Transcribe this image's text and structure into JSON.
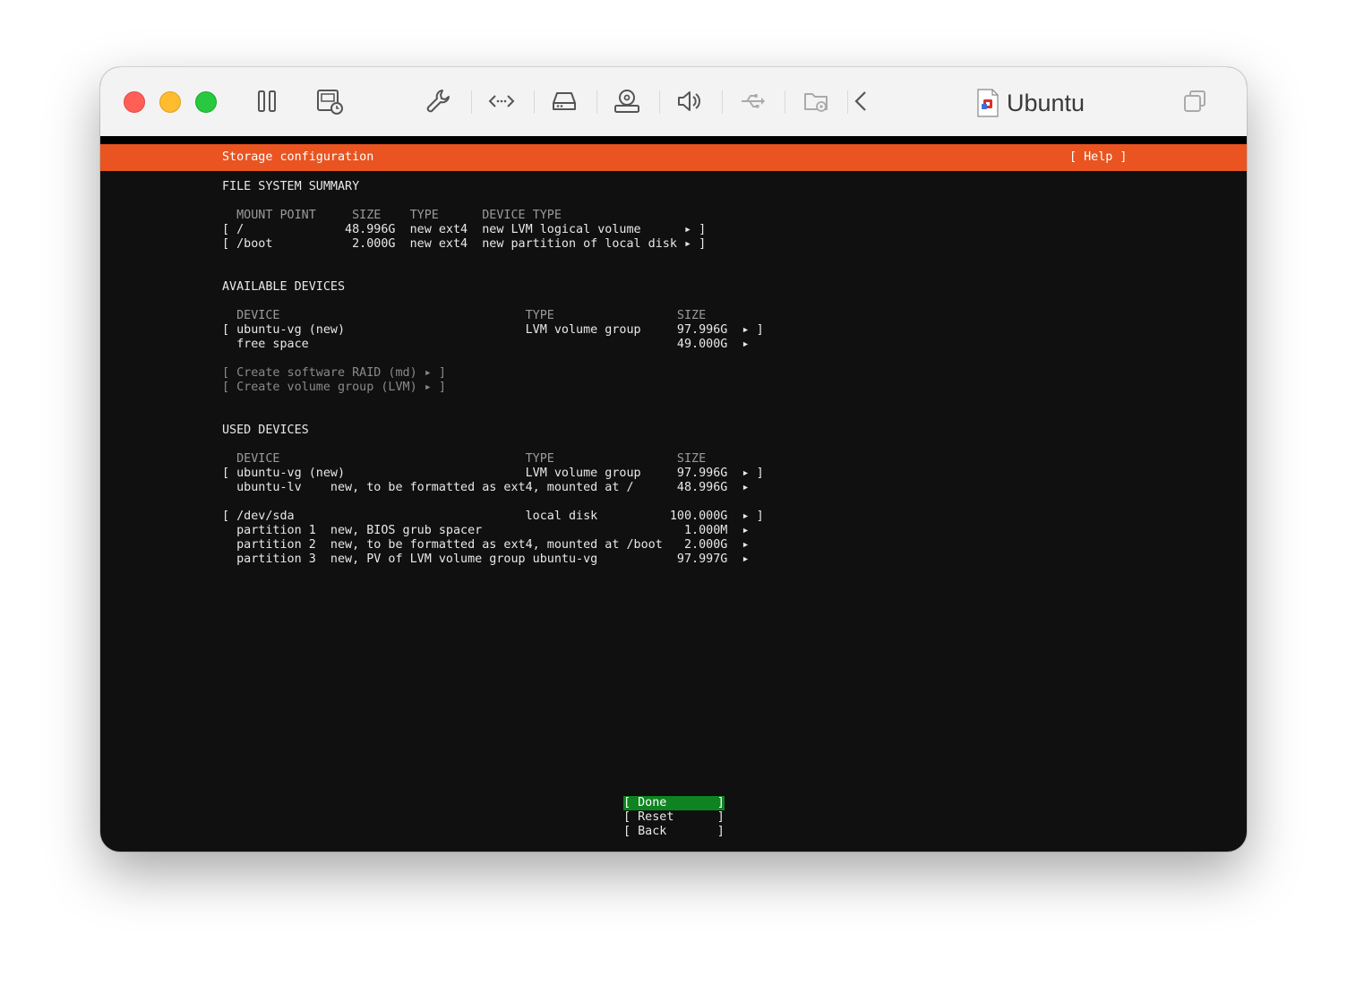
{
  "window": {
    "title": "Ubuntu"
  },
  "toolbar": {
    "icons": [
      "pause-icon",
      "screenshot-icon",
      "wrench-icon",
      "code-arrows-icon",
      "drive-icon",
      "disc-icon",
      "speaker-icon",
      "usb-icon",
      "shared-folder-icon",
      "chevron-left-icon",
      "restore-window-icon"
    ]
  },
  "installer": {
    "header_title": "Storage configuration",
    "help_button": "[ Help ]",
    "fs_summary": {
      "heading": "FILE SYSTEM SUMMARY",
      "column_header": "  MOUNT POINT     SIZE    TYPE      DEVICE TYPE",
      "rows": [
        "[ /              48.996G  new ext4  new LVM logical volume      ▸ ]",
        "[ /boot           2.000G  new ext4  new partition of local disk ▸ ]"
      ]
    },
    "available": {
      "heading": "AVAILABLE DEVICES",
      "column_header": "  DEVICE                                  TYPE                 SIZE",
      "rows": [
        "[ ubuntu-vg (new)                         LVM volume group     97.996G  ▸ ]",
        "  free space                                                   49.000G  ▸"
      ],
      "actions": [
        "[ Create software RAID (md) ▸ ]",
        "[ Create volume group (LVM) ▸ ]"
      ]
    },
    "used": {
      "heading": "USED DEVICES",
      "column_header": "  DEVICE                                  TYPE                 SIZE",
      "group1": [
        "[ ubuntu-vg (new)                         LVM volume group     97.996G  ▸ ]",
        "  ubuntu-lv    new, to be formatted as ext4, mounted at /      48.996G  ▸"
      ],
      "group2": [
        "[ /dev/sda                                local disk          100.000G  ▸ ]",
        "  partition 1  new, BIOS grub spacer                            1.000M  ▸",
        "  partition 2  new, to be formatted as ext4, mounted at /boot   2.000G  ▸",
        "  partition 3  new, PV of LVM volume group ubuntu-vg           97.997G  ▸"
      ]
    },
    "buttons": {
      "done": "[ Done       ]",
      "reset": "[ Reset      ]",
      "back": "[ Back       ]"
    }
  },
  "colors": {
    "header": "#e95420",
    "done_button": "#0e8420",
    "terminal_bg": "#101010"
  }
}
